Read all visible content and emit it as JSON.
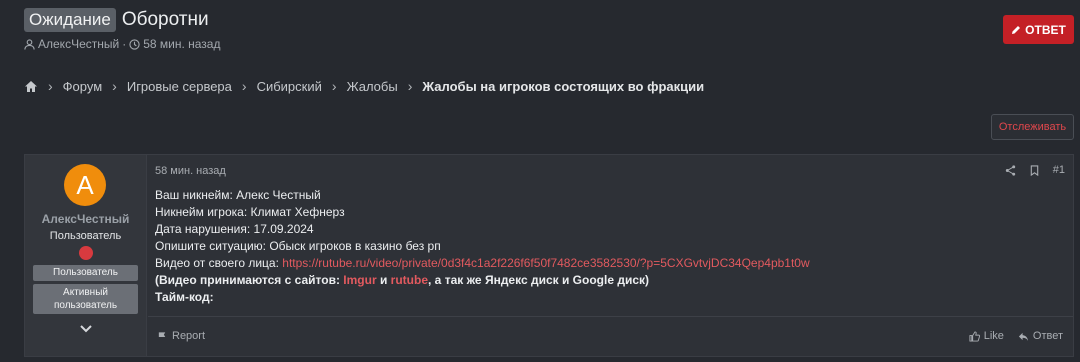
{
  "thread": {
    "status_badge": "Ожидание",
    "title": "Оборотни",
    "author": "АлексЧестный",
    "separator": "·",
    "time_ago": "58 мин. назад",
    "reply_label": "ОТВЕТ",
    "watch_label": "Отслеживать"
  },
  "breadcrumbs": [
    "Форум",
    "Игровые сервера",
    "Сибирский",
    "Жалобы",
    "Жалобы на игроков состоящих во фракции"
  ],
  "post": {
    "user": {
      "avatar_letter": "А",
      "avatar_color": "#f08d0c",
      "name": "АлексЧестный",
      "role": "Пользователь",
      "tags": [
        "Пользователь",
        "Активный пользователь"
      ]
    },
    "time": "58 мин. назад",
    "number": "#1",
    "lines": {
      "l1": "Ваш никнейм: Алекс Честный",
      "l2": "Никнейм игрока: Климат Хефнерз",
      "l3": "Дата нарушения: 17.09.2024",
      "l4": "Опишите ситуацию: Обыск игроков в казино без рп",
      "l5_label": "Видео от своего лица: ",
      "l5_link": "https://rutube.ru/video/private/0d3f4c1a2f226f6f50f7482ce3582530/?p=5CXGvtvjDC34Qep4pb1t0w",
      "l6_a": "(Видео принимаются с сайтов: ",
      "l6_imgur": "Imgur",
      "l6_and": " и ",
      "l6_rutube": "rutube",
      "l6_b": ", а так же Яндекс диск и Google диск)",
      "l7": "Тайм-код:"
    },
    "report_label": "Report",
    "like_label": "Like",
    "reply_label": "Ответ"
  },
  "colors": {
    "accent": "#c42026",
    "link": "#e25a5f",
    "avatar": "#f08d0c"
  }
}
